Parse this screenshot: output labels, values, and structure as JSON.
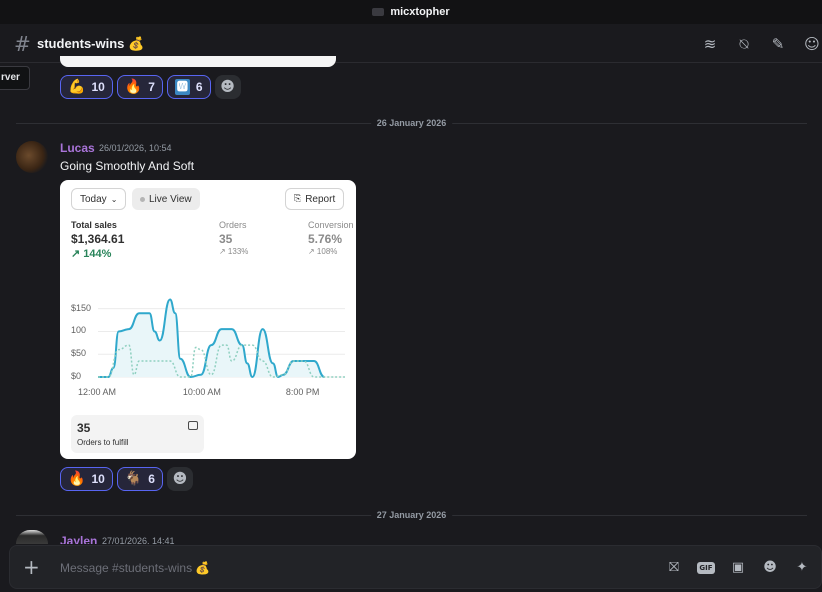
{
  "window": {
    "title": "micxtopher"
  },
  "header": {
    "channel_name": "students-wins 💰",
    "tools": [
      "threads-icon",
      "mute-icon",
      "pin-icon",
      "members-icon"
    ]
  },
  "tooltip": {
    "text": "rver"
  },
  "top_reactions": [
    {
      "emoji": "💪",
      "count": "10"
    },
    {
      "emoji": "🔥",
      "count": "7"
    },
    {
      "emoji": "🆆",
      "count": "6"
    }
  ],
  "dividers": {
    "first": "26 January 2026",
    "second": "27 January 2026"
  },
  "message": {
    "author": "Lucas",
    "timestamp": "26/01/2026, 10:54",
    "text": "Going Smoothly And Soft",
    "embed": {
      "filter_label": "Today",
      "live_label": "Live View",
      "report_label": "Report",
      "metrics": [
        {
          "label": "Total sales",
          "value": "$1,364.61",
          "delta": "↗ 144%"
        },
        {
          "label": "Orders",
          "value": "35",
          "delta": "↗ 133%"
        },
        {
          "label": "Conversion",
          "value": "5.76%",
          "delta": "↗ 108%"
        }
      ],
      "fulfill": {
        "count": "35",
        "label": "Orders to fulfill"
      }
    }
  },
  "chart_data": {
    "type": "line",
    "y_tick_labels": [
      "$150",
      "100",
      "$50",
      "$0"
    ],
    "y_ticks": [
      150,
      100,
      50,
      0
    ],
    "x_tick_labels": [
      "12:00 AM",
      "10:00 AM",
      "8:00 PM"
    ],
    "x_ticks": [
      0,
      10,
      20
    ],
    "ylim": [
      0,
      180
    ],
    "xlim": [
      0,
      24
    ],
    "series": [
      {
        "style": "solid",
        "color": "#2fa8cc",
        "x": [
          0,
          1,
          1.5,
          2,
          3,
          4,
          5,
          5.5,
          6,
          7,
          7.5,
          8,
          9,
          10,
          11,
          12,
          13,
          14,
          14.5,
          15,
          16,
          17,
          17.5,
          18,
          19,
          19.5,
          20,
          21,
          22
        ],
        "y": [
          0,
          0,
          20,
          100,
          105,
          140,
          140,
          100,
          80,
          170,
          140,
          40,
          0,
          5,
          70,
          105,
          105,
          70,
          30,
          0,
          105,
          30,
          0,
          5,
          35,
          35,
          35,
          35,
          0
        ]
      },
      {
        "style": "dashed",
        "color": "#8fd0c0",
        "x": [
          0,
          1,
          2,
          3,
          3.5,
          4,
          5,
          6,
          7,
          8,
          9,
          9.5,
          10,
          11,
          12,
          12.5,
          13,
          14,
          15,
          16,
          17,
          18,
          19,
          20,
          21,
          22,
          24
        ],
        "y": [
          0,
          0,
          60,
          70,
          5,
          35,
          35,
          35,
          35,
          0,
          0,
          65,
          60,
          5,
          70,
          70,
          35,
          70,
          70,
          35,
          0,
          5,
          35,
          35,
          0,
          0,
          0
        ]
      }
    ]
  },
  "bottom_reactions": [
    {
      "emoji": "🔥",
      "count": "10"
    },
    {
      "emoji": "🐐",
      "count": "6"
    }
  ],
  "next_message": {
    "author": "Jaylen",
    "timestamp": "27/01/2026, 14:41"
  },
  "composer": {
    "placeholder": "Message #students-wins 💰",
    "tools": [
      "gift-icon",
      "gif-icon",
      "sticker-icon",
      "emoji-icon",
      "apps-icon"
    ],
    "gif_label": "GIF"
  }
}
